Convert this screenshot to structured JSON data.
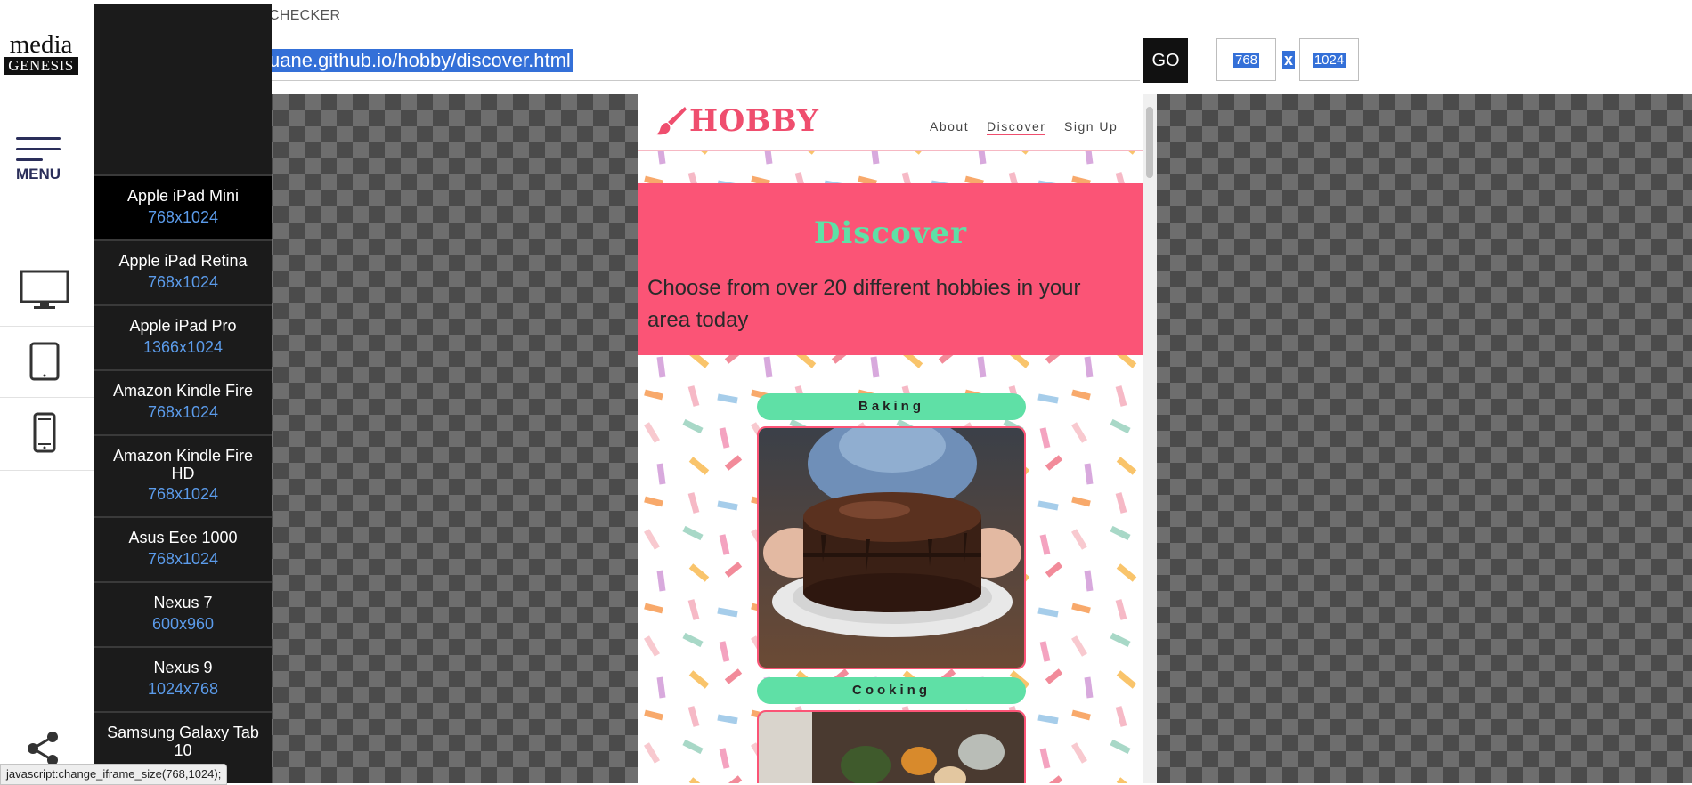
{
  "tool": {
    "title": "CHECKER",
    "url": "uane.github.io/hobby/discover.html",
    "go_label": "GO",
    "width_value": "768",
    "height_value": "1024",
    "x_label": "x"
  },
  "brand": {
    "top": "media",
    "bottom": "GENESIS"
  },
  "rail": {
    "menu_label": "MENU"
  },
  "devices": [
    {
      "name": "Apple iPad Mini",
      "res": "768x1024",
      "active": true
    },
    {
      "name": "Apple iPad Retina",
      "res": "768x1024"
    },
    {
      "name": "Apple iPad Pro",
      "res": "1366x1024"
    },
    {
      "name": "Amazon Kindle Fire",
      "res": "768x1024"
    },
    {
      "name": "Amazon Kindle Fire HD",
      "res": "768x1024"
    },
    {
      "name": "Asus Eee 1000",
      "res": "768x1024"
    },
    {
      "name": "Nexus 7",
      "res": "600x960"
    },
    {
      "name": "Nexus 9",
      "res": "1024x768"
    },
    {
      "name": "Samsung Galaxy Tab 10",
      "res": ""
    }
  ],
  "status_bar": "javascript:change_iframe_size(768,1024);",
  "site": {
    "brand": "HOBBY",
    "nav": [
      "About",
      "Discover",
      "Sign Up"
    ],
    "hero_title": "Discover",
    "hero_sub": "Choose from over 20 different hobbies in your area today",
    "cards": [
      {
        "label": "Baking"
      },
      {
        "label": "Cooking"
      }
    ]
  },
  "colors": {
    "accent_pink": "#fb5476",
    "accent_green": "#5fe0a6",
    "link_blue": "#5b9bea"
  }
}
